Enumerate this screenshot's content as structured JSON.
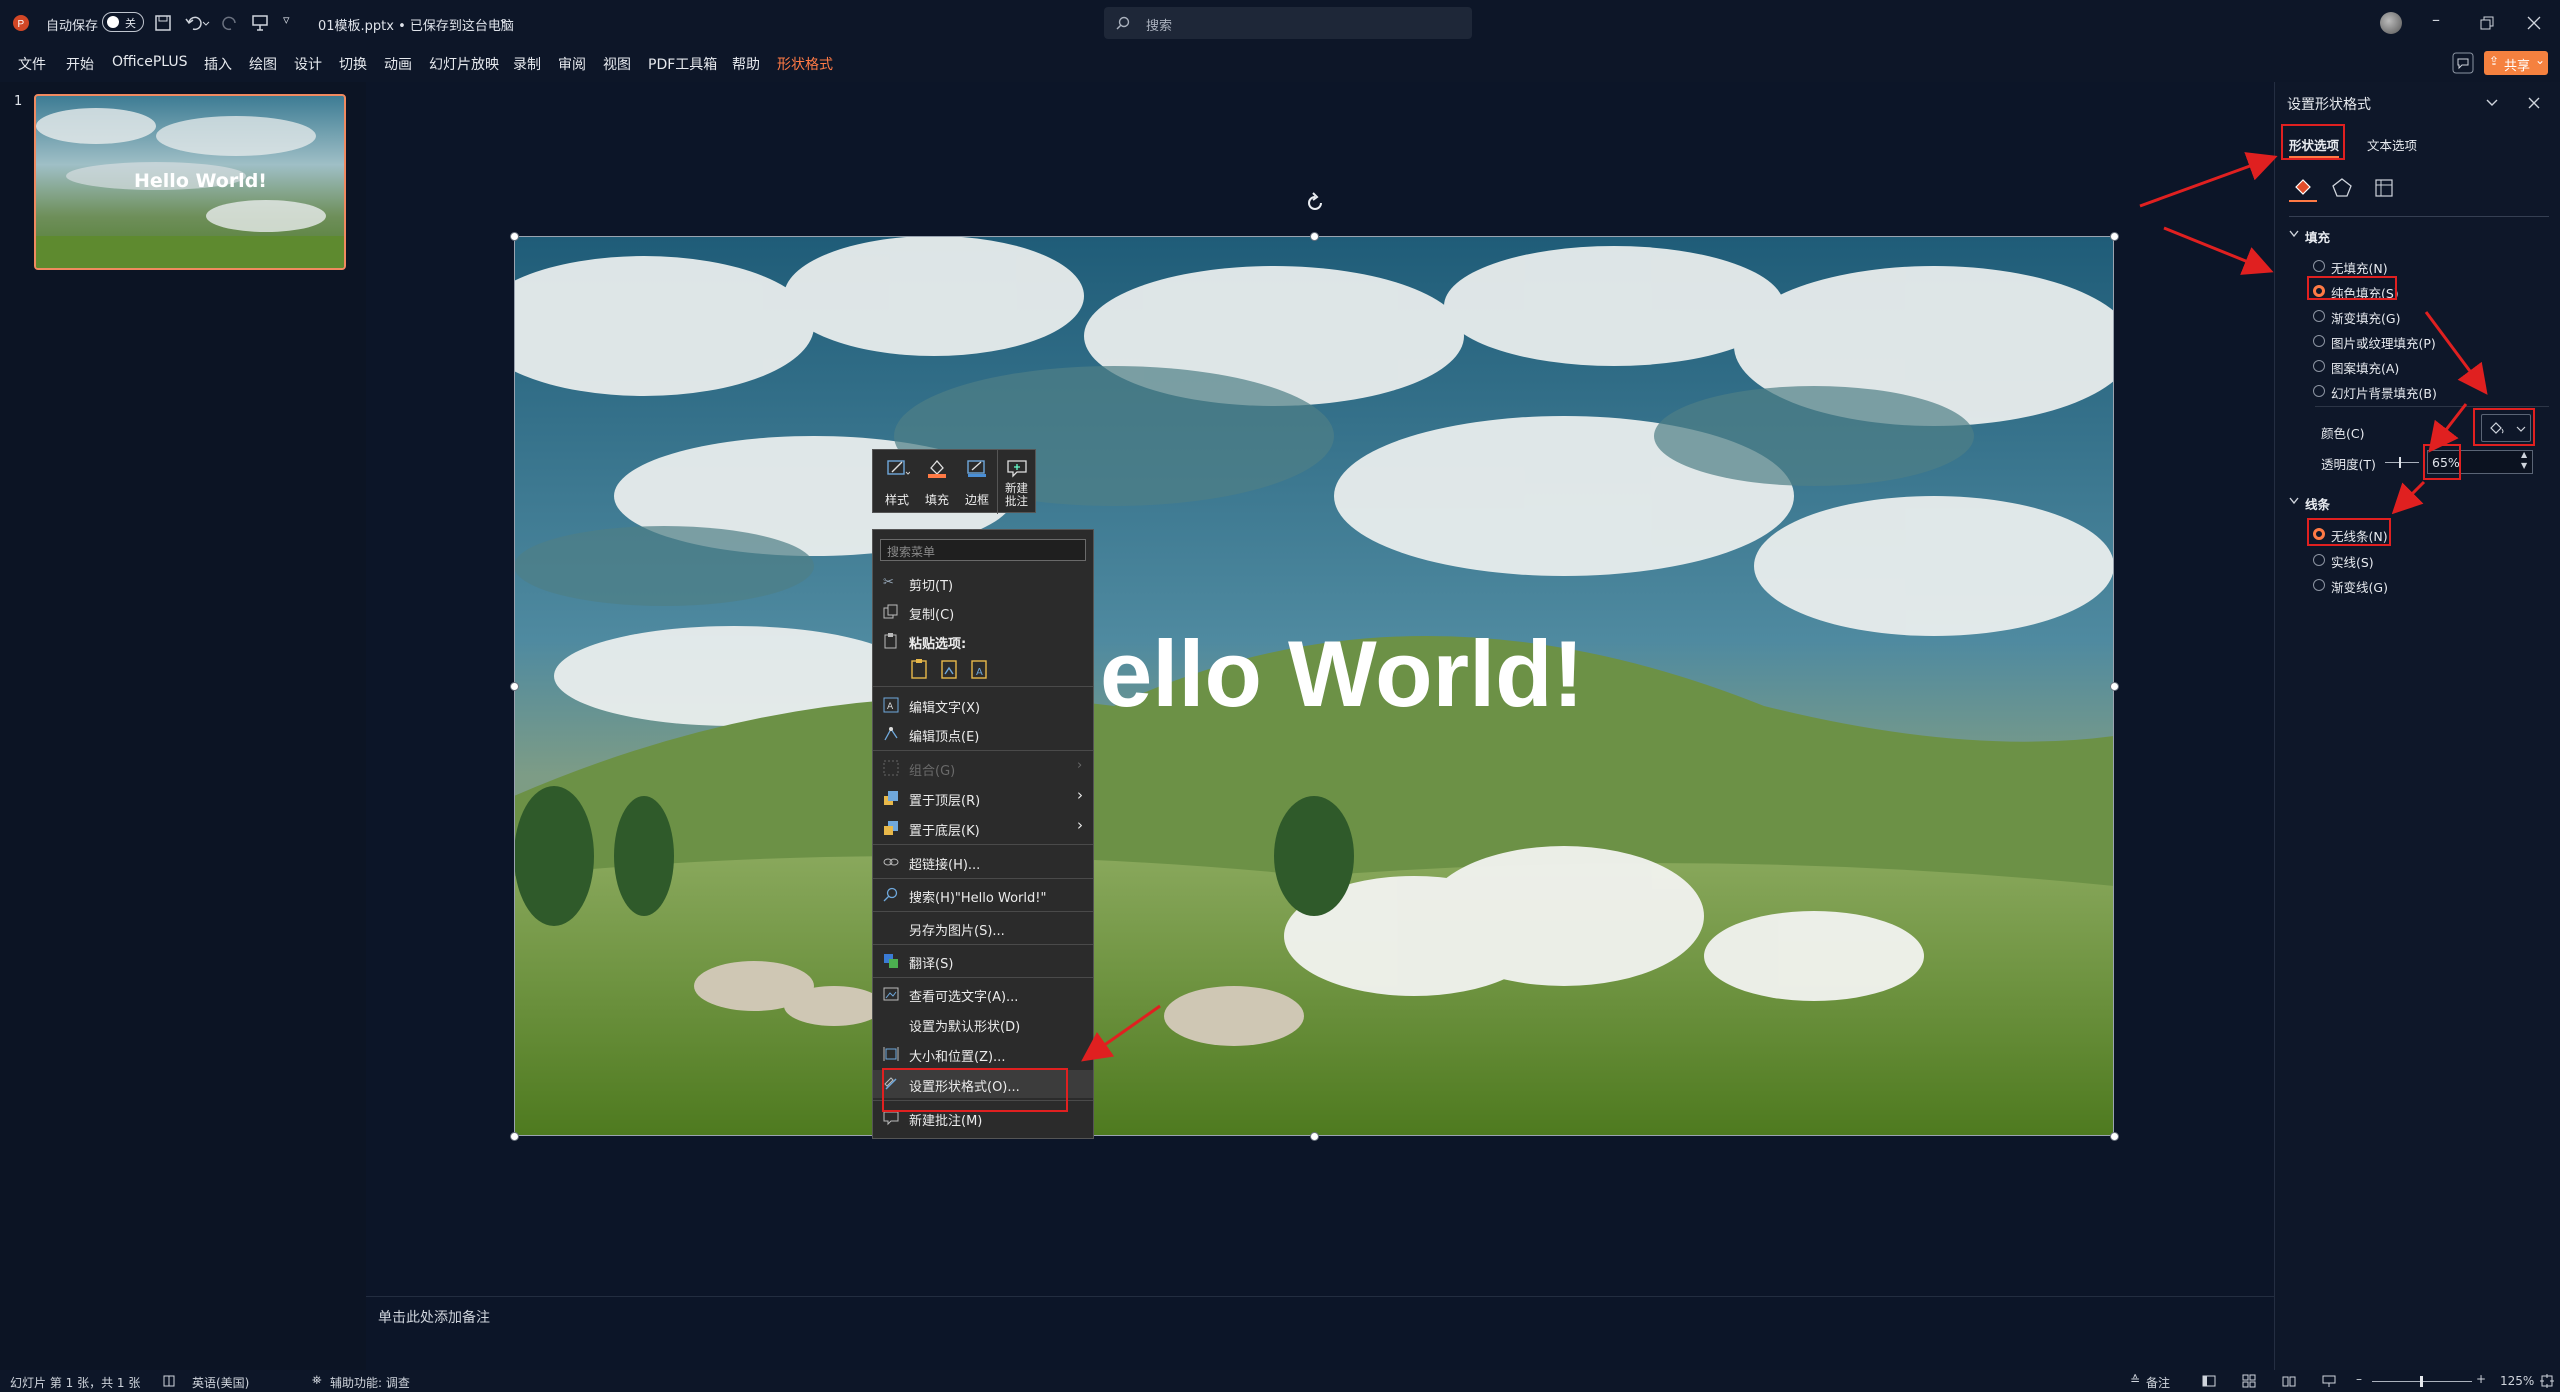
{
  "titlebar": {
    "autosave_label": "自动保存",
    "autosave_toggle": "关",
    "filename": "01模板.pptx • 已保存到这台电脑",
    "filename_chevron": "⌄",
    "search_placeholder": "搜索",
    "share_label": "共享",
    "share_chevron": "⌄"
  },
  "ribbon": {
    "tabs": [
      "文件",
      "开始",
      "OfficePLUS",
      "插入",
      "绘图",
      "设计",
      "切换",
      "动画",
      "幻灯片放映",
      "录制",
      "审阅",
      "视图",
      "PDF工具箱",
      "帮助",
      "形状格式"
    ]
  },
  "thumbs": {
    "slide_number": "1",
    "thumb_text": "Hello World!"
  },
  "slide": {
    "title_text": "ello World!"
  },
  "mini_toolbar": {
    "items": [
      {
        "label": "样式",
        "icon": "style-icon"
      },
      {
        "label": "填充",
        "icon": "fill-icon"
      },
      {
        "label": "边框",
        "icon": "border-icon"
      },
      {
        "label": "新建\n批注",
        "icon": "new-comment-icon"
      }
    ]
  },
  "context_menu": {
    "search_placeholder": "搜索菜单",
    "items": {
      "cut": "剪切(T)",
      "copy": "复制(C)",
      "paste_options": "粘贴选项:",
      "edit_text": "编辑文字(X)",
      "edit_points": "编辑顶点(E)",
      "group": "组合(G)",
      "bring_front": "置于顶层(R)",
      "send_back": "置于底层(K)",
      "hyperlink": "超链接(H)...",
      "search": "搜索(H)\"Hello World!\"",
      "save_picture": "另存为图片(S)...",
      "translate": "翻译(S)",
      "alt_text": "查看可选文字(A)...",
      "set_default": "设置为默认形状(D)",
      "size_position": "大小和位置(Z)...",
      "format_shape": "设置形状格式(O)...",
      "new_comment": "新建批注(M)"
    },
    "submenu_arrow": "›"
  },
  "notes": {
    "placeholder": "单击此处添加备注"
  },
  "format_pane": {
    "title": "设置形状格式",
    "tabs": [
      "形状选项",
      "文本选项"
    ],
    "fill": {
      "header": "填充",
      "options": [
        "无填充(N)",
        "纯色填充(S)",
        "渐变填充(G)",
        "图片或纹理填充(P)",
        "图案填充(A)",
        "幻灯片背景填充(B)"
      ],
      "selected": 1,
      "color_label": "颜色(C)",
      "transparency_label": "透明度(T)",
      "transparency_value": "65%"
    },
    "line": {
      "header": "线条",
      "options": [
        "无线条(N)",
        "实线(S)",
        "渐变线(G)"
      ],
      "selected": 0
    }
  },
  "status": {
    "slide_info": "幻灯片 第 1 张，共 1 张",
    "language": "英语(美国)",
    "accessibility": "辅助功能: 调查",
    "notes_label": "备注",
    "zoom": "125%"
  },
  "colors": {
    "accent": "#ff7a45",
    "annotation_red": "#e02020",
    "background": "#0c1528"
  }
}
